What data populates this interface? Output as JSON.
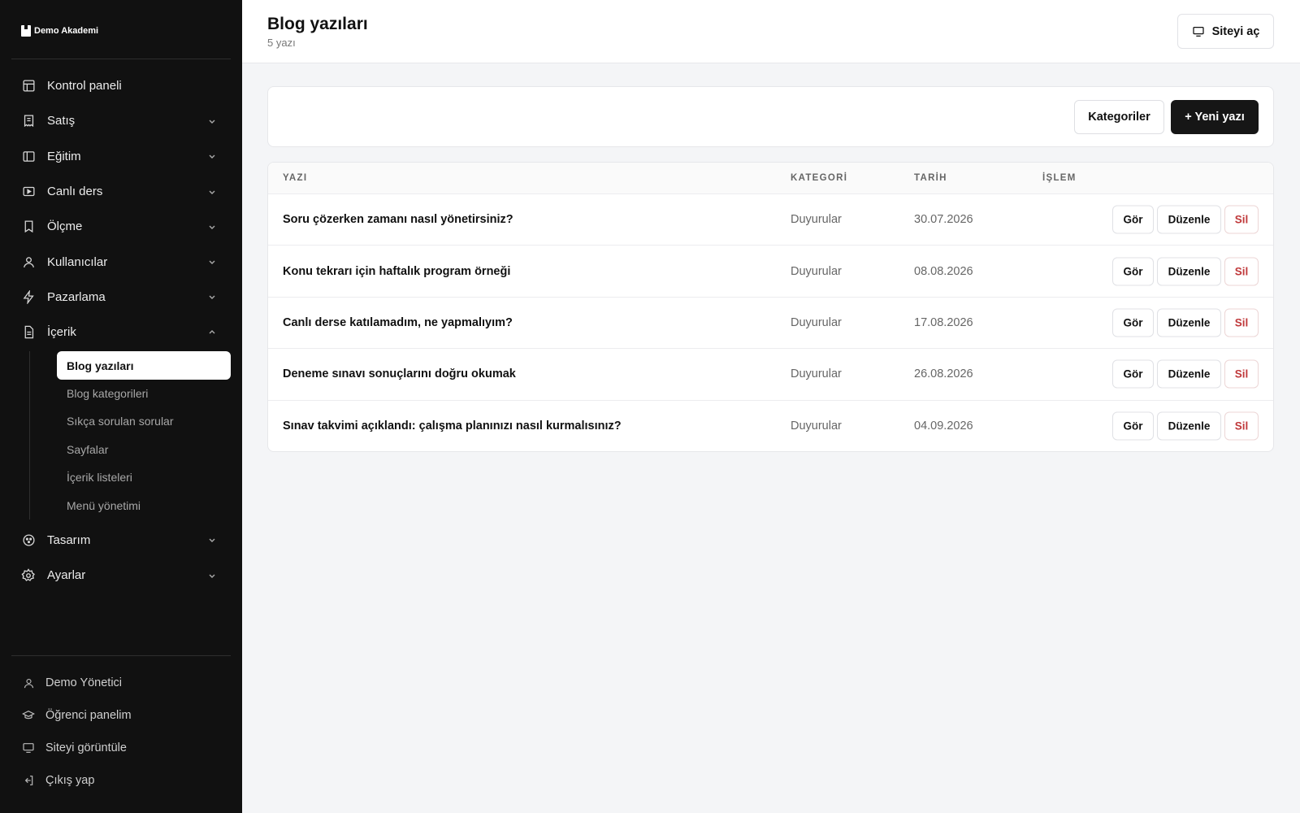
{
  "brand": {
    "name": "Demo Akademi"
  },
  "sidebar": {
    "items": [
      {
        "label": "Kontrol paneli",
        "icon": "layout-icon",
        "chevron": false
      },
      {
        "label": "Satış",
        "icon": "receipt-icon",
        "chevron": "down"
      },
      {
        "label": "Eğitim",
        "icon": "book-panel-icon",
        "chevron": "down"
      },
      {
        "label": "Canlı ders",
        "icon": "video-icon",
        "chevron": "down"
      },
      {
        "label": "Ölçme",
        "icon": "bookmark-icon",
        "chevron": "down"
      },
      {
        "label": "Kullanıcılar",
        "icon": "user-icon",
        "chevron": "down"
      },
      {
        "label": "Pazarlama",
        "icon": "bolt-icon",
        "chevron": "down"
      },
      {
        "label": "İçerik",
        "icon": "document-icon",
        "chevron": "up"
      }
    ],
    "content_submenu": [
      {
        "label": "Blog yazıları",
        "active": true
      },
      {
        "label": "Blog kategorileri",
        "active": false
      },
      {
        "label": "Sıkça sorulan sorular",
        "active": false
      },
      {
        "label": "Sayfalar",
        "active": false
      },
      {
        "label": "İçerik listeleri",
        "active": false
      },
      {
        "label": "Menü yönetimi",
        "active": false
      }
    ],
    "after_items": [
      {
        "label": "Tasarım",
        "icon": "palette-icon",
        "chevron": "down"
      },
      {
        "label": "Ayarlar",
        "icon": "gear-icon",
        "chevron": "down"
      }
    ],
    "footer": [
      {
        "label": "Demo Yönetici",
        "icon": "user-icon"
      },
      {
        "label": "Öğrenci panelim",
        "icon": "graduation-cap-icon"
      },
      {
        "label": "Siteyi görüntüle",
        "icon": "monitor-icon"
      },
      {
        "label": "Çıkış yap",
        "icon": "logout-icon"
      }
    ]
  },
  "header": {
    "title": "Blog yazıları",
    "subtitle": "5 yazı",
    "site_button": "Siteyi aç"
  },
  "toolbar": {
    "categories_button": "Kategoriler",
    "new_post_button": "+ Yeni yazı"
  },
  "table": {
    "columns": [
      "YAZI",
      "KATEGORİ",
      "TARİH",
      "İŞLEM"
    ],
    "rows": [
      {
        "title": "Soru çözerken zamanı nasıl yönetirsiniz?",
        "category": "Duyurular",
        "date": "30.07.2026"
      },
      {
        "title": "Konu tekrarı için haftalık program örneği",
        "category": "Duyurular",
        "date": "08.08.2026"
      },
      {
        "title": "Canlı derse katılamadım, ne yapmalıyım?",
        "category": "Duyurular",
        "date": "17.08.2026"
      },
      {
        "title": "Deneme sınavı sonuçlarını doğru okumak",
        "category": "Duyurular",
        "date": "26.08.2026"
      },
      {
        "title": "Sınav takvimi açıklandı: çalışma planınızı nasıl kurmalısınız?",
        "category": "Duyurular",
        "date": "04.09.2026"
      }
    ],
    "actions": {
      "view": "Gör",
      "edit": "Düzenle",
      "delete": "Sil"
    }
  },
  "colors": {
    "sidebar_bg": "#111111",
    "delete_red": "#c0393b",
    "primary_button": "#161616"
  }
}
